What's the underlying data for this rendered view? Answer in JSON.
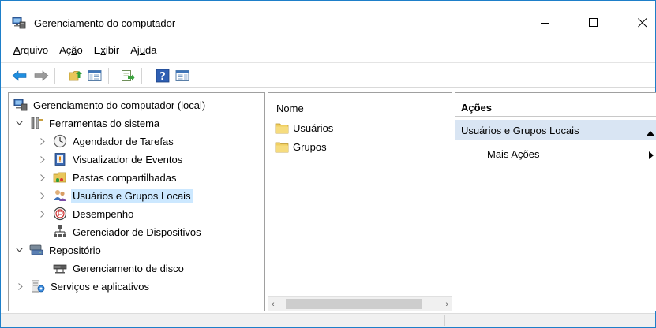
{
  "window": {
    "title": "Gerenciamento do computador",
    "minimize_label": "—",
    "maximize_label": "☐",
    "close_label": "✕"
  },
  "menu": {
    "items": [
      {
        "label_before": "",
        "key": "A",
        "label_after": "rquivo"
      },
      {
        "label_before": "Aç",
        "key": "ã",
        "label_after": "o"
      },
      {
        "label_before": "E",
        "key": "x",
        "label_after": "ibir"
      },
      {
        "label_before": "Aj",
        "key": "u",
        "label_after": "da"
      }
    ]
  },
  "toolbar": {
    "buttons": [
      "back-icon",
      "forward-icon",
      "up-folder-icon",
      "show-hide-tree-icon",
      "export-list-icon",
      "help-icon",
      "show-hide-action-pane-icon"
    ]
  },
  "tree": {
    "root": "Gerenciamento do computador (local)",
    "system_tools": "Ferramentas do sistema",
    "task_scheduler": "Agendador de Tarefas",
    "event_viewer": "Visualizador de Eventos",
    "shared_folders": "Pastas compartilhadas",
    "local_users": "Usuários e Grupos Locais",
    "performance": "Desempenho",
    "device_manager": "Gerenciador de Dispositivos",
    "storage": "Repositório",
    "disk_management": "Gerenciamento de disco",
    "services": "Serviços e aplicativos"
  },
  "list": {
    "column_name": "Nome",
    "items": [
      "Usuários",
      "Grupos"
    ]
  },
  "actions": {
    "title": "Ações",
    "group": "Usuários e Grupos Locais",
    "more": "Mais Ações"
  },
  "colors": {
    "accent_border": "#1e7fc9",
    "selection": "#cce8ff",
    "actions_group_bg": "#d9e5f3",
    "folder_yellow": "#e8c65a"
  }
}
